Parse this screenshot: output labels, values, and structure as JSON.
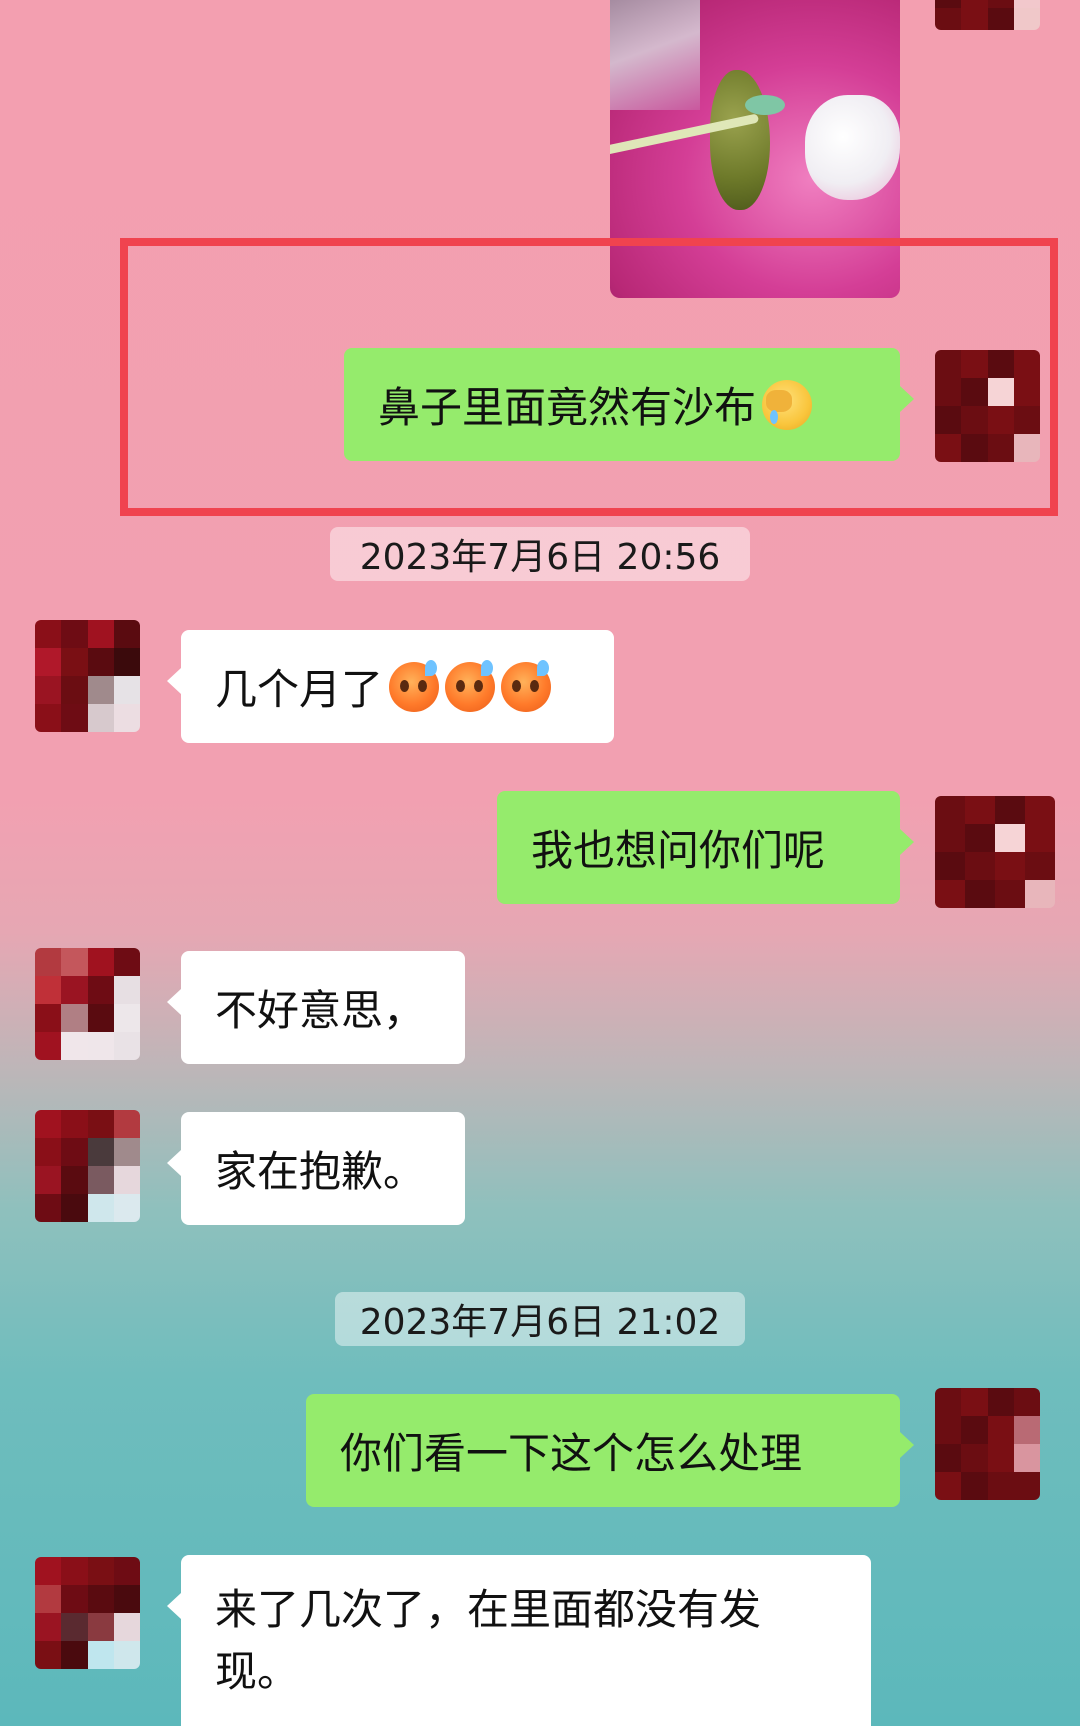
{
  "messages": [
    {
      "side": "right",
      "type": "image"
    },
    {
      "side": "right",
      "type": "text",
      "text": "鼻子里面竟然有沙布",
      "emoji": [
        "face-with-tears-facepalm"
      ]
    },
    {
      "type": "timestamp",
      "text": "2023年7月6日 20:56"
    },
    {
      "side": "left",
      "type": "text",
      "text": "几个月了",
      "emoji": [
        "anxious-face-with-sweat",
        "anxious-face-with-sweat",
        "anxious-face-with-sweat"
      ]
    },
    {
      "side": "right",
      "type": "text",
      "text": "我也想问你们呢"
    },
    {
      "side": "left",
      "type": "text",
      "text": "不好意思，"
    },
    {
      "side": "left",
      "type": "text",
      "text": "家在抱歉。"
    },
    {
      "type": "timestamp",
      "text": "2023年7月6日 21:02"
    },
    {
      "side": "right",
      "type": "text",
      "text": "你们看一下这个怎么处理"
    },
    {
      "side": "left",
      "type": "text",
      "text": "来了几次了，在里面都没有发现。"
    }
  ],
  "colors": {
    "sent_bubble": "#95eb6c",
    "received_bubble": "#ffffff",
    "highlight_box": "#f0434f"
  },
  "annotations": {
    "highlight_box_target": "message 2"
  }
}
